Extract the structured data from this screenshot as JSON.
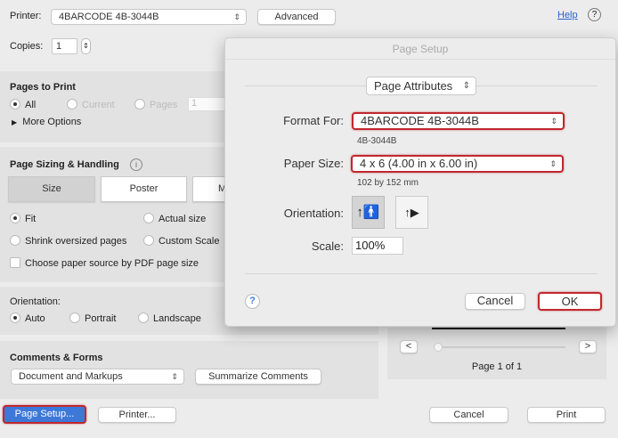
{
  "print_dialog": {
    "printer_label": "Printer:",
    "printer_value": "4BARCODE 4B-3044B",
    "advanced_label": "Advanced",
    "help_label": "Help",
    "copies_label": "Copies:",
    "copies_value": "1",
    "pages_to_print": {
      "title": "Pages to Print",
      "all": "All",
      "current": "Current",
      "pages": "Pages",
      "pages_value": "1",
      "more_options": "More Options"
    },
    "page_sizing": {
      "title": "Page Sizing & Handling",
      "tabs": [
        "Size",
        "Poster",
        "M"
      ],
      "fit": "Fit",
      "actual_size": "Actual size",
      "shrink": "Shrink oversized pages",
      "custom_scale": "Custom Scale",
      "paper_source": "Choose paper source by PDF page size"
    },
    "orientation": {
      "title": "Orientation:",
      "auto": "Auto",
      "portrait": "Portrait",
      "landscape": "Landscape"
    },
    "comments_forms": {
      "title": "Comments & Forms",
      "select_value": "Document and Markups",
      "summarize": "Summarize Comments"
    },
    "preview": {
      "page_indicator": "Page 1 of 1",
      "prev": "<",
      "next": ">"
    },
    "footer": {
      "page_setup": "Page Setup...",
      "printer": "Printer...",
      "cancel": "Cancel",
      "print": "Print"
    }
  },
  "page_setup": {
    "title": "Page Setup",
    "popup": "Page Attributes",
    "format_for_label": "Format For:",
    "format_for_value": "4BARCODE 4B-3044B",
    "format_for_sub": "4B-3044B",
    "paper_size_label": "Paper Size:",
    "paper_size_value": "4 x 6 (4.00 in x 6.00 in)",
    "paper_size_sub": "102 by 152 mm",
    "orientation_label": "Orientation:",
    "scale_label": "Scale:",
    "scale_value": "100%",
    "help": "?",
    "cancel": "Cancel",
    "ok": "OK"
  },
  "colors": {
    "highlight_red": "#c0282e",
    "page_setup_blue": "#3d78d8"
  }
}
